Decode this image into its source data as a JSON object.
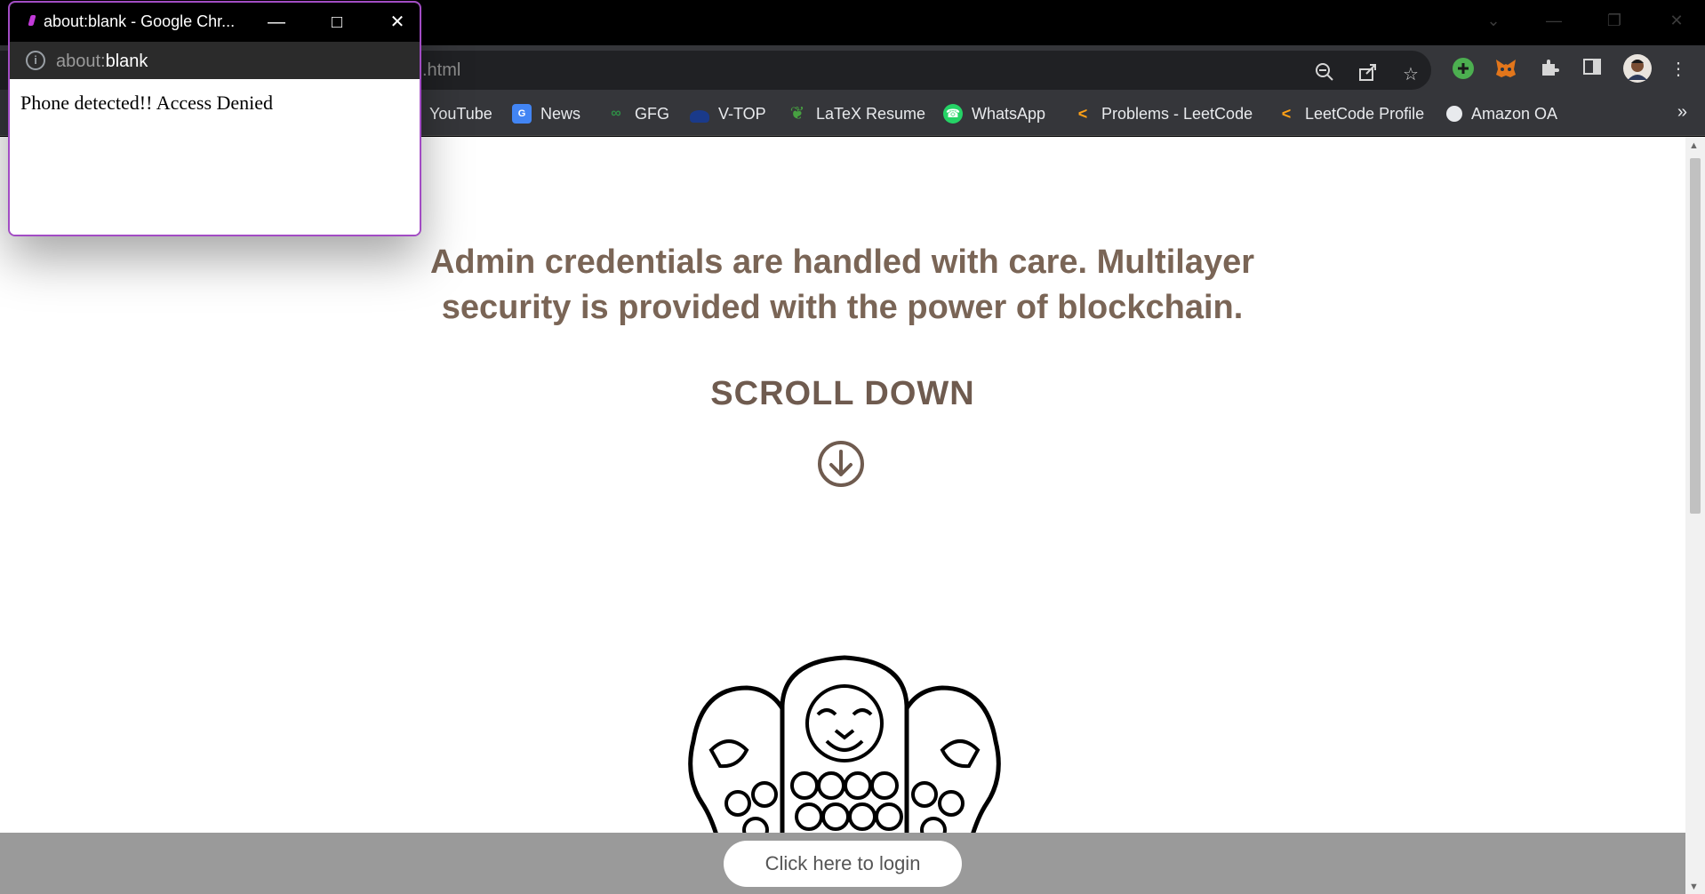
{
  "browser": {
    "url_fragment": ".html",
    "bookmarks": [
      {
        "label": "YouTube",
        "icon": "youtube-icon",
        "color": "#ff0000"
      },
      {
        "label": "News",
        "icon": "news-icon",
        "color": "#4285f4"
      },
      {
        "label": "GFG",
        "icon": "gfg-icon",
        "color": "#2f8d46"
      },
      {
        "label": "V-TOP",
        "icon": "vtop-icon",
        "color": "#1a3a8a"
      },
      {
        "label": "LaTeX Resume",
        "icon": "leaf-icon",
        "color": "#47a141"
      },
      {
        "label": "WhatsApp",
        "icon": "whatsapp-icon",
        "color": "#25d366"
      },
      {
        "label": "Problems - LeetCode",
        "icon": "leetcode-icon",
        "color": "#ffa116"
      },
      {
        "label": "LeetCode Profile",
        "icon": "leetcode-icon",
        "color": "#ffa116"
      },
      {
        "label": "Amazon OA",
        "icon": "globe-icon",
        "color": "#e8eaed"
      }
    ],
    "more_bookmarks": "»"
  },
  "page": {
    "headline": "Admin credentials are handled with care. Multilayer security is provided with the power of blockchain.",
    "scroll_label": "SCROLL DOWN",
    "login_button": "Click here to login",
    "text_color": "#7a6556",
    "footer_color": "#9a9a9a"
  },
  "popup": {
    "title": "about:blank - Google Chr...",
    "address_dim": "about:",
    "address_bright": "blank",
    "message": "Phone detected!! Access Denied",
    "border_color": "#a24cc4"
  }
}
